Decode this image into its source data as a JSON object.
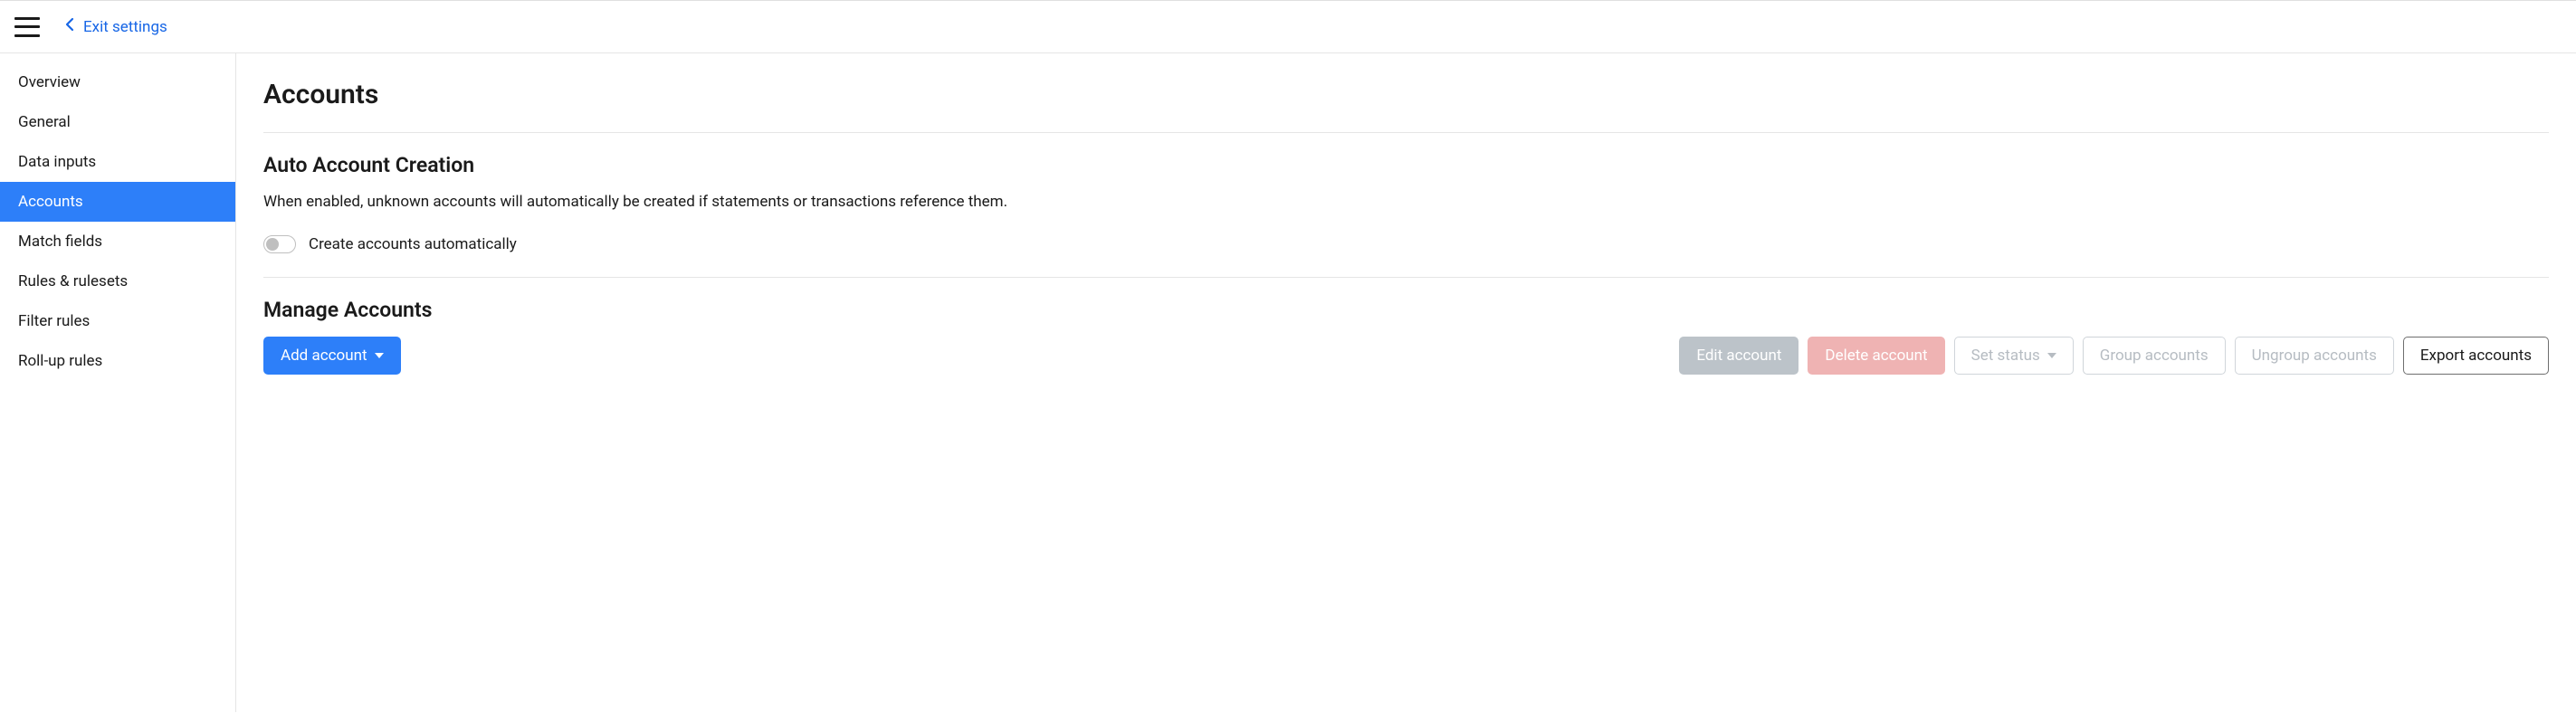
{
  "header": {
    "exit_label": "Exit settings"
  },
  "sidebar": {
    "items": [
      {
        "label": "Overview",
        "active": false
      },
      {
        "label": "General",
        "active": false
      },
      {
        "label": "Data inputs",
        "active": false
      },
      {
        "label": "Accounts",
        "active": true
      },
      {
        "label": "Match fields",
        "active": false
      },
      {
        "label": "Rules & rulesets",
        "active": false
      },
      {
        "label": "Filter rules",
        "active": false
      },
      {
        "label": "Roll-up rules",
        "active": false
      }
    ]
  },
  "page": {
    "title": "Accounts",
    "auto_section": {
      "heading": "Auto Account Creation",
      "description": "When enabled, unknown accounts will automatically be created if statements or transactions reference them.",
      "toggle_label": "Create accounts automatically",
      "toggle_on": false
    },
    "manage_section": {
      "heading": "Manage Accounts",
      "add_label": "Add account",
      "edit_label": "Edit account",
      "delete_label": "Delete account",
      "set_status_label": "Set status",
      "group_label": "Group accounts",
      "ungroup_label": "Ungroup accounts",
      "export_label": "Export accounts"
    }
  }
}
